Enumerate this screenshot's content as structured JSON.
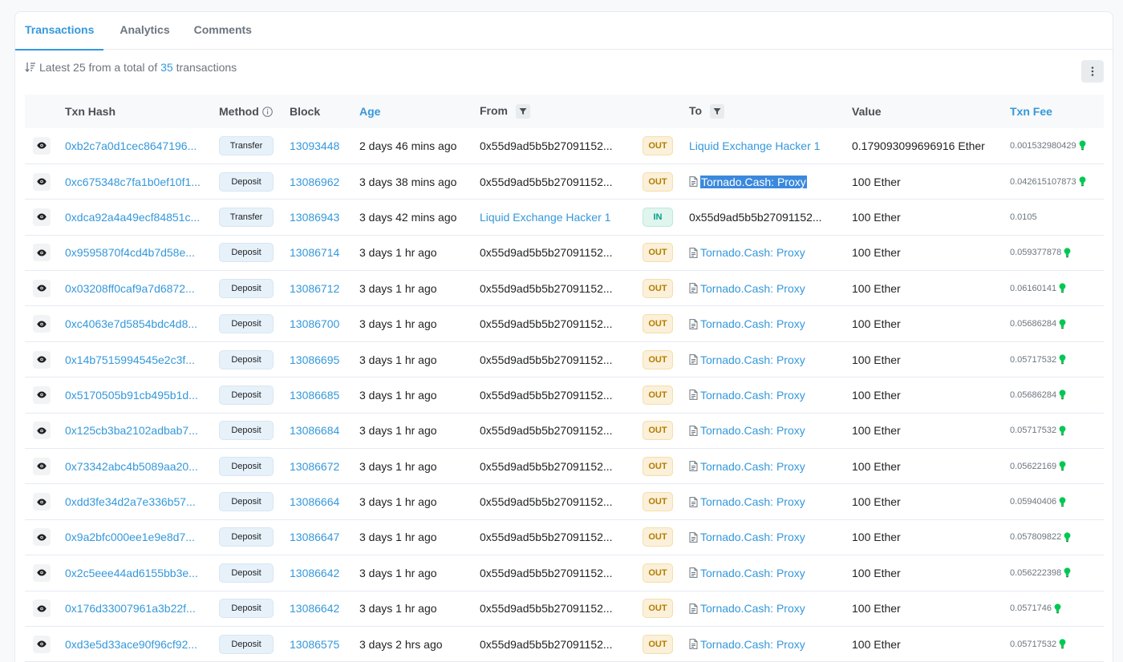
{
  "tabs": [
    {
      "label": "Transactions",
      "active": true
    },
    {
      "label": "Analytics",
      "active": false
    },
    {
      "label": "Comments",
      "active": false
    }
  ],
  "summary": {
    "prefix": "Latest 25 from a total of",
    "count": "35",
    "suffix": "transactions"
  },
  "columns": {
    "hash": "Txn Hash",
    "method": "Method",
    "block": "Block",
    "age": "Age",
    "from": "From",
    "to": "To",
    "value": "Value",
    "fee": "Txn Fee"
  },
  "colors": {
    "link": "#3498db",
    "out_badge": "#fbf0d9",
    "in_badge": "#dff5ee",
    "fee_bulb": "#00c853"
  },
  "rows": [
    {
      "hash": "0xb2c7a0d1cec8647196...",
      "method": "Transfer",
      "block": "13093448",
      "age": "2 days 46 mins ago",
      "from": "0x55d9ad5b5b27091152...",
      "from_link": false,
      "dir": "OUT",
      "to": "Liquid Exchange Hacker 1",
      "to_contract": false,
      "to_link": true,
      "to_highlight": false,
      "value": "0.179093099696916 Ether",
      "fee": "0.001532980429",
      "fee_bulb": true
    },
    {
      "hash": "0xc675348c7fa1b0ef10f1...",
      "method": "Deposit",
      "block": "13086962",
      "age": "3 days 38 mins ago",
      "from": "0x55d9ad5b5b27091152...",
      "from_link": false,
      "dir": "OUT",
      "to": "Tornado.Cash: Proxy",
      "to_contract": true,
      "to_link": true,
      "to_highlight": true,
      "value": "100 Ether",
      "fee": "0.042615107873",
      "fee_bulb": true
    },
    {
      "hash": "0xdca92a4a49ecf84851c...",
      "method": "Transfer",
      "block": "13086943",
      "age": "3 days 42 mins ago",
      "from": "Liquid Exchange Hacker 1",
      "from_link": true,
      "dir": "IN",
      "to": "0x55d9ad5b5b27091152...",
      "to_contract": false,
      "to_link": false,
      "to_highlight": false,
      "value": "100 Ether",
      "fee": "0.0105",
      "fee_bulb": false
    },
    {
      "hash": "0x9595870f4cd4b7d58e...",
      "method": "Deposit",
      "block": "13086714",
      "age": "3 days 1 hr ago",
      "from": "0x55d9ad5b5b27091152...",
      "from_link": false,
      "dir": "OUT",
      "to": "Tornado.Cash: Proxy",
      "to_contract": true,
      "to_link": true,
      "to_highlight": false,
      "value": "100 Ether",
      "fee": "0.059377878",
      "fee_bulb": true
    },
    {
      "hash": "0x03208ff0caf9a7d6872...",
      "method": "Deposit",
      "block": "13086712",
      "age": "3 days 1 hr ago",
      "from": "0x55d9ad5b5b27091152...",
      "from_link": false,
      "dir": "OUT",
      "to": "Tornado.Cash: Proxy",
      "to_contract": true,
      "to_link": true,
      "to_highlight": false,
      "value": "100 Ether",
      "fee": "0.06160141",
      "fee_bulb": true
    },
    {
      "hash": "0xc4063e7d5854bdc4d8...",
      "method": "Deposit",
      "block": "13086700",
      "age": "3 days 1 hr ago",
      "from": "0x55d9ad5b5b27091152...",
      "from_link": false,
      "dir": "OUT",
      "to": "Tornado.Cash: Proxy",
      "to_contract": true,
      "to_link": true,
      "to_highlight": false,
      "value": "100 Ether",
      "fee": "0.05686284",
      "fee_bulb": true
    },
    {
      "hash": "0x14b7515994545e2c3f...",
      "method": "Deposit",
      "block": "13086695",
      "age": "3 days 1 hr ago",
      "from": "0x55d9ad5b5b27091152...",
      "from_link": false,
      "dir": "OUT",
      "to": "Tornado.Cash: Proxy",
      "to_contract": true,
      "to_link": true,
      "to_highlight": false,
      "value": "100 Ether",
      "fee": "0.05717532",
      "fee_bulb": true
    },
    {
      "hash": "0x5170505b91cb495b1d...",
      "method": "Deposit",
      "block": "13086685",
      "age": "3 days 1 hr ago",
      "from": "0x55d9ad5b5b27091152...",
      "from_link": false,
      "dir": "OUT",
      "to": "Tornado.Cash: Proxy",
      "to_contract": true,
      "to_link": true,
      "to_highlight": false,
      "value": "100 Ether",
      "fee": "0.05686284",
      "fee_bulb": true
    },
    {
      "hash": "0x125cb3ba2102adbab7...",
      "method": "Deposit",
      "block": "13086684",
      "age": "3 days 1 hr ago",
      "from": "0x55d9ad5b5b27091152...",
      "from_link": false,
      "dir": "OUT",
      "to": "Tornado.Cash: Proxy",
      "to_contract": true,
      "to_link": true,
      "to_highlight": false,
      "value": "100 Ether",
      "fee": "0.05717532",
      "fee_bulb": true
    },
    {
      "hash": "0x73342abc4b5089aa20...",
      "method": "Deposit",
      "block": "13086672",
      "age": "3 days 1 hr ago",
      "from": "0x55d9ad5b5b27091152...",
      "from_link": false,
      "dir": "OUT",
      "to": "Tornado.Cash: Proxy",
      "to_contract": true,
      "to_link": true,
      "to_highlight": false,
      "value": "100 Ether",
      "fee": "0.05622169",
      "fee_bulb": true
    },
    {
      "hash": "0xdd3fe34d2a7e336b57...",
      "method": "Deposit",
      "block": "13086664",
      "age": "3 days 1 hr ago",
      "from": "0x55d9ad5b5b27091152...",
      "from_link": false,
      "dir": "OUT",
      "to": "Tornado.Cash: Proxy",
      "to_contract": true,
      "to_link": true,
      "to_highlight": false,
      "value": "100 Ether",
      "fee": "0.05940406",
      "fee_bulb": true
    },
    {
      "hash": "0x9a2bfc000ee1e9e8d7...",
      "method": "Deposit",
      "block": "13086647",
      "age": "3 days 1 hr ago",
      "from": "0x55d9ad5b5b27091152...",
      "from_link": false,
      "dir": "OUT",
      "to": "Tornado.Cash: Proxy",
      "to_contract": true,
      "to_link": true,
      "to_highlight": false,
      "value": "100 Ether",
      "fee": "0.057809822",
      "fee_bulb": true
    },
    {
      "hash": "0x2c5eee44ad6155bb3e...",
      "method": "Deposit",
      "block": "13086642",
      "age": "3 days 1 hr ago",
      "from": "0x55d9ad5b5b27091152...",
      "from_link": false,
      "dir": "OUT",
      "to": "Tornado.Cash: Proxy",
      "to_contract": true,
      "to_link": true,
      "to_highlight": false,
      "value": "100 Ether",
      "fee": "0.056222398",
      "fee_bulb": true
    },
    {
      "hash": "0x176d33007961a3b22f...",
      "method": "Deposit",
      "block": "13086642",
      "age": "3 days 1 hr ago",
      "from": "0x55d9ad5b5b27091152...",
      "from_link": false,
      "dir": "OUT",
      "to": "Tornado.Cash: Proxy",
      "to_contract": true,
      "to_link": true,
      "to_highlight": false,
      "value": "100 Ether",
      "fee": "0.0571746",
      "fee_bulb": true
    },
    {
      "hash": "0xd3e5d33ace90f96cf92...",
      "method": "Deposit",
      "block": "13086575",
      "age": "3 days 2 hrs ago",
      "from": "0x55d9ad5b5b27091152...",
      "from_link": false,
      "dir": "OUT",
      "to": "Tornado.Cash: Proxy",
      "to_contract": true,
      "to_link": true,
      "to_highlight": false,
      "value": "100 Ether",
      "fee": "0.05717532",
      "fee_bulb": true
    }
  ]
}
